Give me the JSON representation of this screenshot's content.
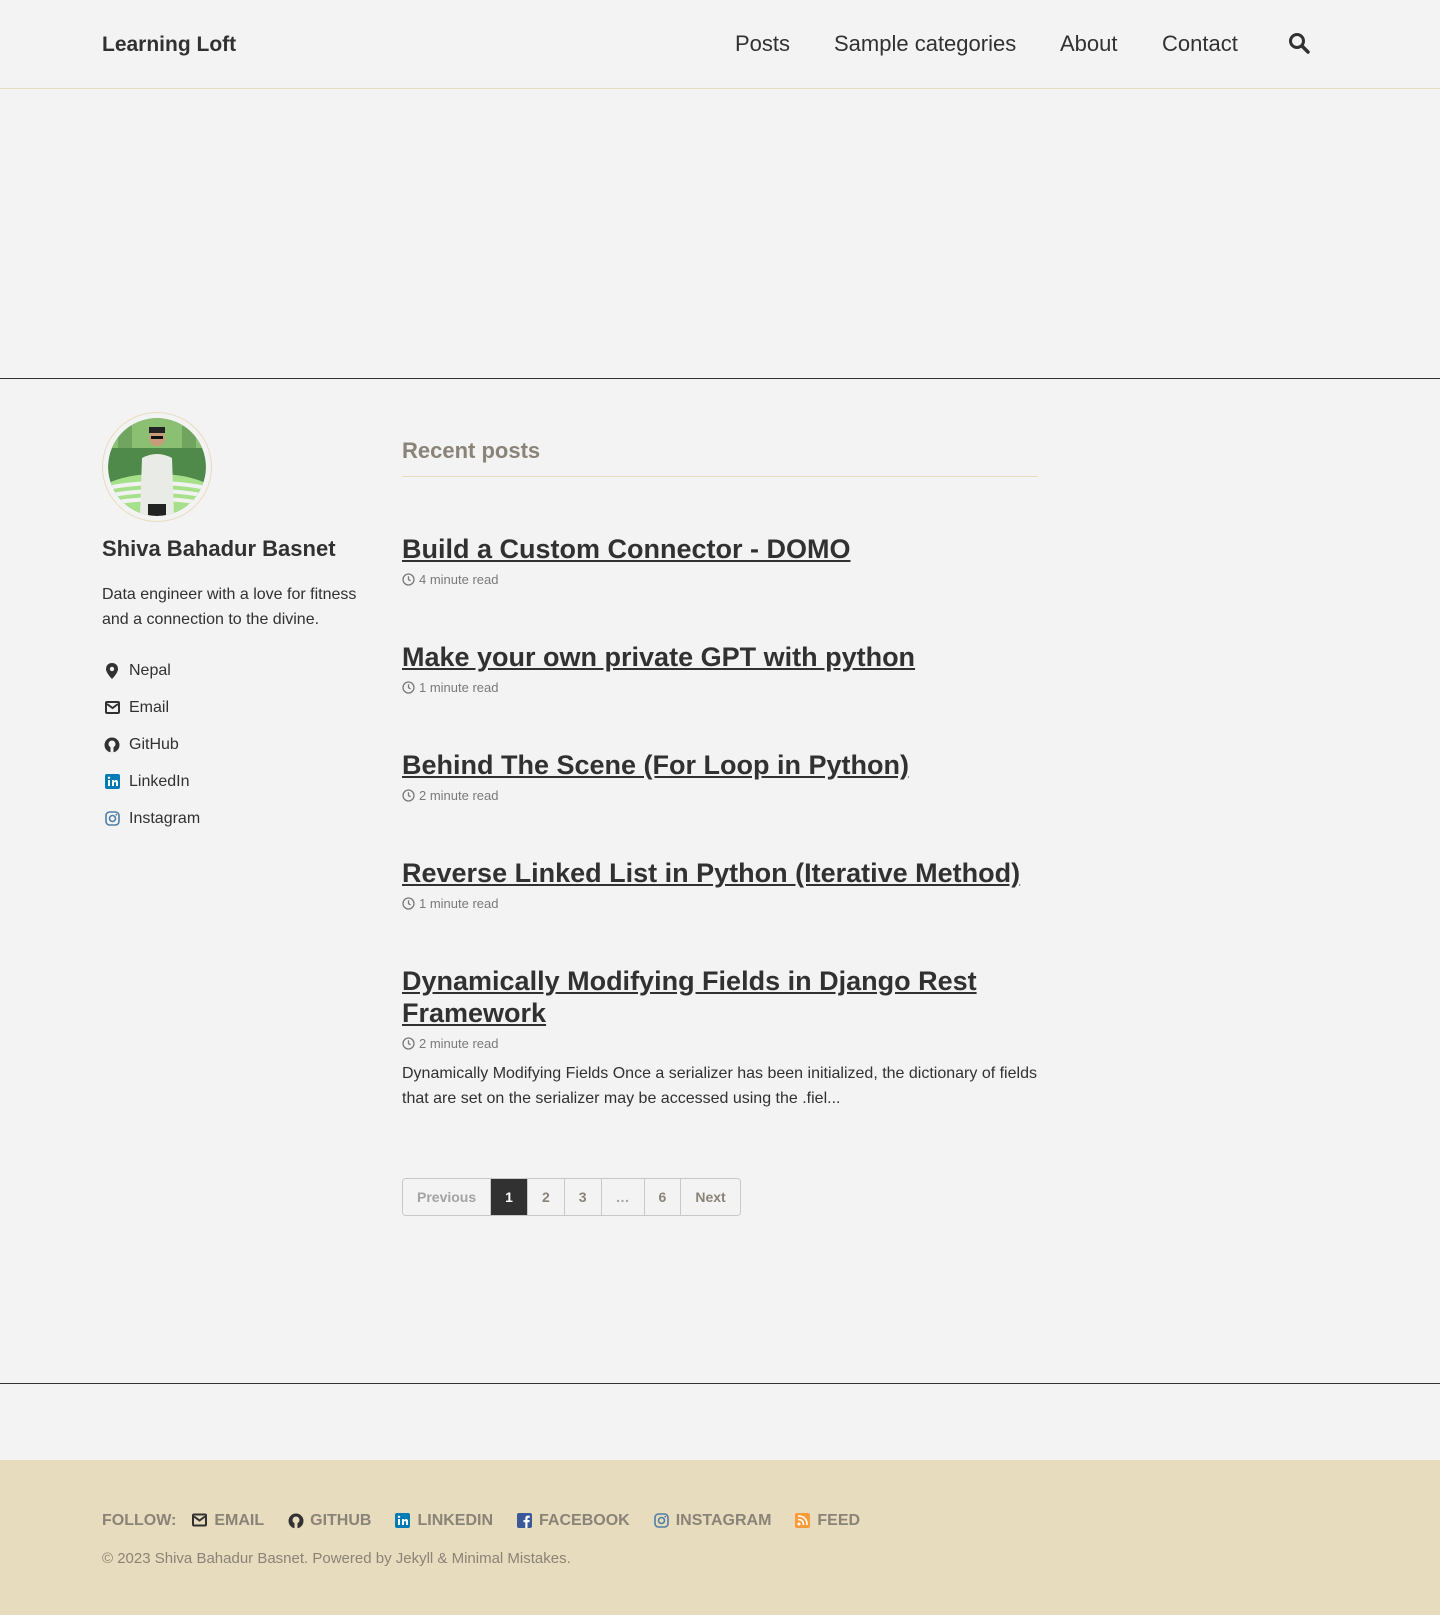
{
  "header": {
    "site_title": "Learning Loft",
    "nav": [
      {
        "label": "Posts"
      },
      {
        "label": "Sample categories"
      },
      {
        "label": "About"
      },
      {
        "label": "Contact"
      }
    ],
    "search_icon": "search-icon"
  },
  "sidebar": {
    "author_name": "Shiva Bahadur Basnet",
    "bio": "Data engineer with a love for fitness and a connection to the divine.",
    "links": [
      {
        "label": "Nepal",
        "icon": "map-marker-icon"
      },
      {
        "label": "Email",
        "icon": "envelope-icon"
      },
      {
        "label": "GitHub",
        "icon": "github-icon"
      },
      {
        "label": "LinkedIn",
        "icon": "linkedin-icon"
      },
      {
        "label": "Instagram",
        "icon": "instagram-icon"
      }
    ]
  },
  "main": {
    "section_title": "Recent posts",
    "posts": [
      {
        "title": "Build a Custom Connector - DOMO",
        "read_time": "4 minute read"
      },
      {
        "title": "Make your own private GPT with python",
        "read_time": "1 minute read"
      },
      {
        "title": "Behind The Scene (For Loop in Python)",
        "read_time": "2 minute read"
      },
      {
        "title": "Reverse Linked List in Python (Iterative Method)",
        "read_time": "1 minute read"
      },
      {
        "title": "Dynamically Modifying Fields in Django Rest Framework",
        "read_time": "2 minute read",
        "excerpt": "Dynamically Modifying Fields Once a serializer has been initialized, the dictionary of fields that are set on the serializer may be accessed using the .fiel..."
      }
    ],
    "pagination": {
      "previous": "Previous",
      "pages": [
        "1",
        "2",
        "3",
        "…",
        "6"
      ],
      "current": "1",
      "next": "Next"
    }
  },
  "footer": {
    "follow_label": "FOLLOW:",
    "links": [
      {
        "label": "EMAIL",
        "icon": "envelope-icon"
      },
      {
        "label": "GITHUB",
        "icon": "github-icon"
      },
      {
        "label": "LINKEDIN",
        "icon": "linkedin-icon"
      },
      {
        "label": "FACEBOOK",
        "icon": "facebook-icon"
      },
      {
        "label": "INSTAGRAM",
        "icon": "instagram-icon"
      },
      {
        "label": "FEED",
        "icon": "rss-icon"
      }
    ],
    "copyright": "© 2023 Shiva Bahadur Basnet. Powered by Jekyll & Minimal Mistakes."
  },
  "colors": {
    "background": "#f3f3f3",
    "text": "#313131",
    "muted": "#8a8377",
    "footer_bg": "#e8dcbe",
    "linkedin": "#007bb6",
    "facebook": "#3b5998",
    "rss": "#fa9b39"
  }
}
